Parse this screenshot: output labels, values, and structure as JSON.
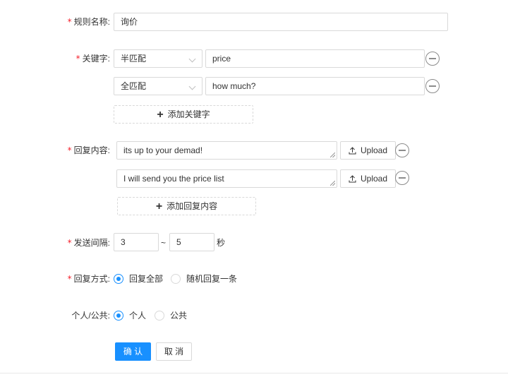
{
  "form": {
    "rule_name": {
      "label": "规则名称:",
      "value": "询价"
    },
    "keywords": {
      "label": "关键字:",
      "rows": [
        {
          "match": "半匹配",
          "value": "price"
        },
        {
          "match": "全匹配",
          "value": "how much?"
        }
      ],
      "add_label": "添加关键字"
    },
    "replies": {
      "label": "回复内容:",
      "rows": [
        {
          "value": "its up to your demad!",
          "upload_label": "Upload"
        },
        {
          "value": "I will send you the price list",
          "upload_label": "Upload"
        }
      ],
      "add_label": "添加回复内容"
    },
    "interval": {
      "label": "发送间隔:",
      "min": "3",
      "separator": "~",
      "max": "5",
      "unit": "秒"
    },
    "reply_mode": {
      "label": "回复方式:",
      "options": [
        {
          "label": "回复全部",
          "checked": true
        },
        {
          "label": "随机回复一条",
          "checked": false
        }
      ]
    },
    "visibility": {
      "label": "个人/公共:",
      "options": [
        {
          "label": "个人",
          "checked": true
        },
        {
          "label": "公共",
          "checked": false
        }
      ]
    },
    "actions": {
      "confirm_label": "确 认",
      "cancel_label": "取 消"
    }
  },
  "colors": {
    "primary": "#1890ff",
    "required": "#f5222d",
    "border": "#d9d9d9"
  },
  "icons": {
    "remove": "minus-circle-icon",
    "add": "plus-icon",
    "upload": "upload-icon",
    "select": "chevron-down-icon"
  }
}
